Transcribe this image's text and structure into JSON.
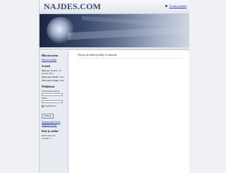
{
  "site": {
    "logo": "NAJDES.COM",
    "home_link": "Úvodní stránka"
  },
  "sidebar": {
    "menu_heading": "Hlavní menu",
    "menu_link": "Hlavní stránka",
    "calendar_heading": "Svátek",
    "today_label": "Dnes je:",
    "today_value": "Neděle, 25. května 2025",
    "today_name_label": "Dnes má svátek:",
    "today_name": "Viola",
    "tomorrow_name_label": "Zítra má svátek:",
    "tomorrow_name": "Filip",
    "login_heading": "Přihlášení",
    "username_label": "Uživatelské jméno",
    "password_label": "Heslo",
    "remember_label": "Zapamatovat",
    "login_button": "Přihlásit",
    "forgot_link": "Zapomenuté heslo",
    "register_link": "Registrovat se!",
    "online_heading": "Kdo je online",
    "online_line": "Právě zde jsou",
    "online_count": "Čtenáři : 3"
  },
  "main": {
    "notice": "Nejsou zde žádné položky k zobrazení"
  }
}
